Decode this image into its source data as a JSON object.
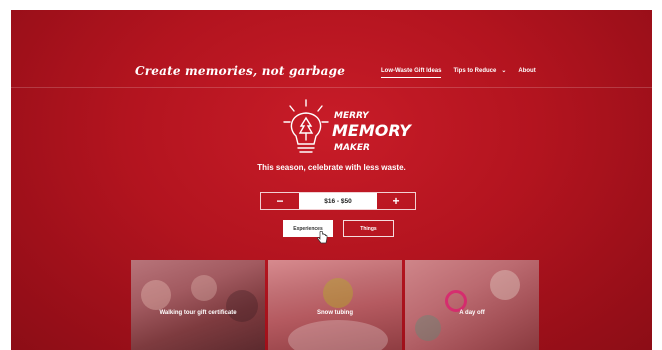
{
  "header": {
    "brand": "Create memories, not garbage",
    "nav": [
      {
        "label": "Low-Waste Gift Ideas",
        "active": true
      },
      {
        "label": "Tips to Reduce",
        "has_dropdown": true
      },
      {
        "label": "About"
      }
    ]
  },
  "logo": {
    "line1": "MERRY",
    "line2": "MEMORY",
    "line3": "MAKER"
  },
  "tagline": "This season, celebrate with less waste.",
  "price_filter": {
    "decrement": "−",
    "value": "$16 - $50",
    "increment": "+"
  },
  "filters": {
    "experiences": "Experiences",
    "things": "Things",
    "selected": "Experiences"
  },
  "cards": [
    {
      "label": "Walking tour gift certificate"
    },
    {
      "label": "Snow tubing"
    },
    {
      "label": "A day off"
    }
  ],
  "colors": {
    "background": "#b3141f",
    "accent": "#ffffff"
  }
}
